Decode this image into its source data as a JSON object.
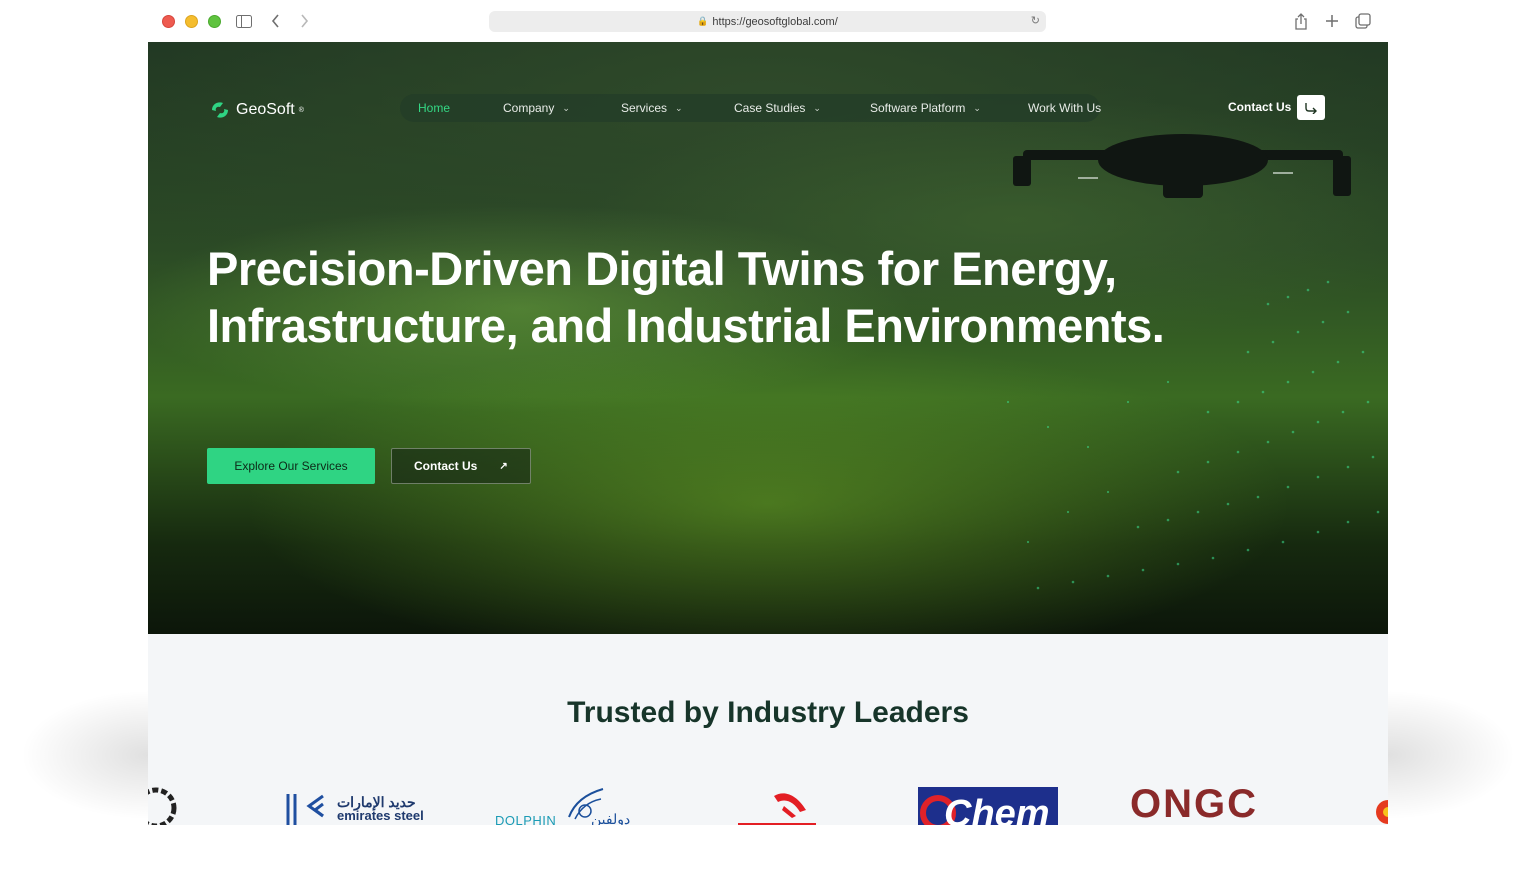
{
  "browser": {
    "url": "https://geosoftglobal.com/"
  },
  "header": {
    "logo_text": "GeoSoft",
    "logo_mark": "®",
    "nav": [
      {
        "label": "Home",
        "active": true,
        "has_dropdown": false
      },
      {
        "label": "Company",
        "active": false,
        "has_dropdown": true
      },
      {
        "label": "Services",
        "active": false,
        "has_dropdown": true
      },
      {
        "label": "Case Studies",
        "active": false,
        "has_dropdown": true
      },
      {
        "label": "Software Platform",
        "active": false,
        "has_dropdown": true
      },
      {
        "label": "Work With Us",
        "active": false,
        "has_dropdown": false
      }
    ],
    "contact_label": "Contact Us"
  },
  "hero": {
    "headline": "Precision-Driven Digital Twins for Energy, Infrastructure, and Industrial Environments.",
    "primary_cta": "Explore Our Services",
    "secondary_cta": "Contact Us"
  },
  "trusted": {
    "title": "Trusted by Industry Leaders",
    "logos": [
      {
        "name": "emirates steel",
        "text_ar": "حديد الإمارات",
        "text_en": "emirates steel"
      },
      {
        "name": "Dolphin",
        "text_ar": "دولفين",
        "text_en": "DOLPHIN"
      },
      {
        "name": "Orlen",
        "text_en": ""
      },
      {
        "name": "Chem",
        "text_en": "Chem"
      },
      {
        "name": "ONGC",
        "text_en": "ONGC"
      }
    ]
  },
  "colors": {
    "accent": "#2fd483",
    "nav_active": "#34d884",
    "heading_dark": "#17352a",
    "section_bg": "#f4f6f8"
  }
}
